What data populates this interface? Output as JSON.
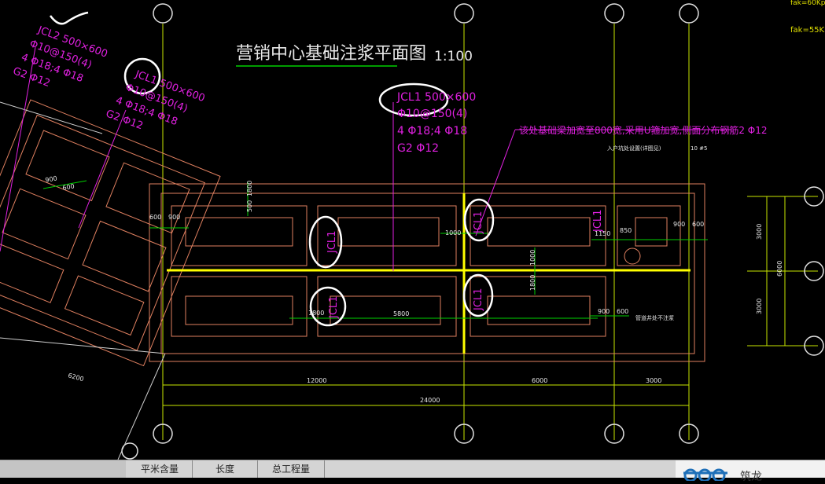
{
  "drawing": {
    "title": "营销中心基础注浆平面图",
    "scale": "1:100",
    "fak_top": "fak=60Kp",
    "fak_2": "fak=55KP",
    "beam_jcl1": {
      "name": "JCL1 500×600",
      "stirrup": "Φ10@150(4)",
      "rebar": "4 Φ18;4 Φ18",
      "side": "G2 Φ12"
    },
    "beam_jcl2": {
      "name": "JCL2 500×600",
      "stirrup": "Φ10@150(4)",
      "rebar": "4 Φ18;4 Φ18",
      "side": "G2 Φ12"
    },
    "beam_jcl1_left": {
      "name": "JCL1 500×600",
      "stirrup": "Φ10@150(4)",
      "rebar": "4 Φ18;4 Φ18",
      "side": "G2 Φ12"
    },
    "note_widen": "该处基础梁加宽至800宽,采用U箍加宽,侧面分布钢筋2 Φ12",
    "note_small_1": "入户坑处设置(详图见)",
    "note_small_2": "10 #5",
    "note_small_3": "管道井处不注浆",
    "beam_labels": [
      "JCL1",
      "JCL1",
      "JCL1",
      "JCL1",
      "JCL1"
    ],
    "dims": {
      "total": "24000",
      "span1": "12000",
      "span2": "6000",
      "span3": "3000",
      "right_upper": "3000",
      "right_total": "6000",
      "right_lower": "3000",
      "d600": "600",
      "d900": "900",
      "d1000": "1000",
      "d1150": "1150",
      "d850": "850",
      "d5800": "5800",
      "d1800": "1800",
      "d6200": "6200",
      "d500": "500"
    }
  },
  "table_headers": [
    "平米含量",
    "长度",
    "总工程量"
  ],
  "logo_text": "筑龙"
}
